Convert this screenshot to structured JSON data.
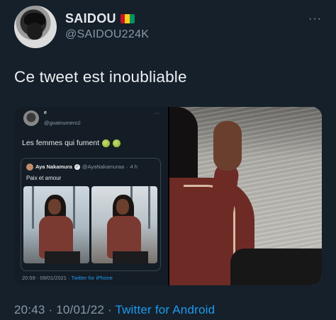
{
  "author": {
    "name": "SAIDOU",
    "handle": "@SAIDOU224K",
    "flag_colors": [
      "#ce1126",
      "#fcd116",
      "#009460"
    ]
  },
  "tweet": {
    "text": "Ce tweet est inoubliable",
    "time": "20:43 · 10/01/22 · ",
    "source": "Twitter for Android"
  },
  "embedded": {
    "author_name": "e",
    "author_handle": "@goatnumero2",
    "text": "Les femmes qui fument",
    "emojis": [
      "nauseated-face",
      "nauseated-face"
    ],
    "more": "···",
    "quote": {
      "name": "Aya Nakamura",
      "handle": "@AyaNakamuraa",
      "age": "4 h",
      "text": "Paix et amour"
    },
    "time": "20:59 · 09/01/2021 · ",
    "source": "Twitter for iPhone"
  },
  "ui": {
    "more_icon": "···",
    "accent": "#1d9bf0",
    "background": "#15202b"
  }
}
